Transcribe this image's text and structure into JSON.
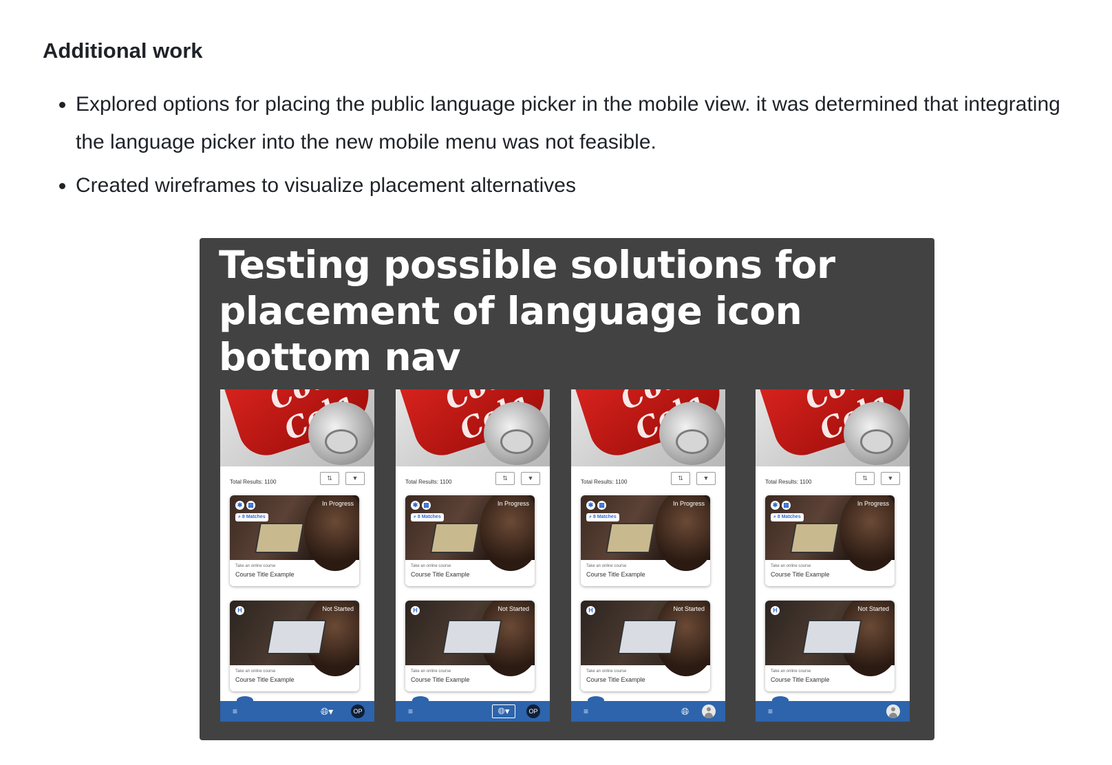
{
  "section": {
    "heading": "Additional work",
    "bullets": [
      "Explored options for placing the public language picker in the mobile view. it was determined that integrating the language picker into the new mobile menu was not feasible.",
      "Created wireframes to visualize placement alternatives"
    ]
  },
  "figure": {
    "title": "Testing possible solutions for placement of language icon bottom nav",
    "hero_logo_text": "Coca-Cola",
    "phones": [
      {
        "total_results": "Total Results: 1100",
        "cards": [
          {
            "status": "In Progress",
            "matches": "8 Matches",
            "subtitle": "Take an online course",
            "title": "Course Title Example"
          },
          {
            "status": "Not Started",
            "subtitle": "Take an online course",
            "title": "Course Title Example"
          }
        ],
        "nav": {
          "language": "globe-with-caret",
          "avatar_initials": "OP"
        }
      },
      {
        "total_results": "Total Results: 1100",
        "cards": [
          {
            "status": "In Progress",
            "matches": "8 Matches",
            "subtitle": "Take an online course",
            "title": "Course Title Example"
          },
          {
            "status": "Not Started",
            "subtitle": "Take an online course",
            "title": "Course Title Example"
          }
        ],
        "nav": {
          "language": "globe-boxed-with-caret",
          "avatar_initials": "OP"
        }
      },
      {
        "total_results": "Total Results: 1100",
        "cards": [
          {
            "status": "In Progress",
            "matches": "8 Matches",
            "subtitle": "Take an online course",
            "title": "Course Title Example"
          },
          {
            "status": "Not Started",
            "subtitle": "Take an online course",
            "title": "Course Title Example"
          }
        ],
        "nav": {
          "language": "globe",
          "avatar": "person-icon"
        }
      },
      {
        "total_results": "Total Results: 1100",
        "cards": [
          {
            "status": "In Progress",
            "matches": "8 Matches",
            "subtitle": "Take an online course",
            "title": "Course Title Example"
          },
          {
            "status": "Not Started",
            "subtitle": "Take an online course",
            "title": "Course Title Example"
          }
        ],
        "nav": {
          "language": "none",
          "avatar": "person-icon"
        }
      }
    ]
  },
  "colors": {
    "figure_bg": "#424242",
    "nav_blue": "#2d64ac",
    "chip_blue": "#2f6bd6"
  }
}
